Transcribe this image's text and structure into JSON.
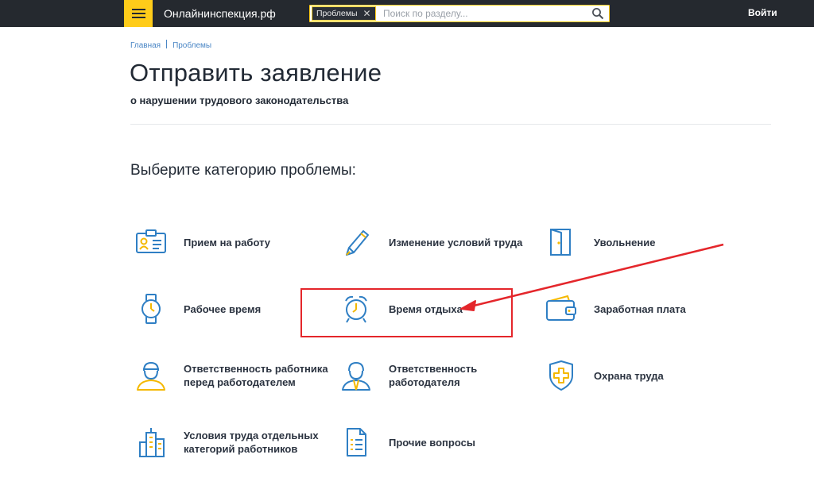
{
  "header": {
    "site_name": "Онлайнинспекция.рф",
    "search_tag": "Проблемы",
    "search_placeholder": "Поиск по разделу...",
    "login_label": "Войти",
    "brand_color": "#ffcc1a"
  },
  "breadcrumb": [
    {
      "label": "Главная"
    },
    {
      "label": "Проблемы"
    }
  ],
  "page": {
    "title": "Отправить заявление",
    "subtitle": "о нарушении трудового законодательства",
    "section_title": "Выберите категорию проблемы:"
  },
  "categories": [
    {
      "label": "Прием на работу",
      "icon": "id-badge-icon"
    },
    {
      "label": "Изменение условий труда",
      "icon": "pen-icon"
    },
    {
      "label": "Увольнение",
      "icon": "door-exit-icon"
    },
    {
      "label": "Рабочее время",
      "icon": "wristwatch-icon"
    },
    {
      "label": "Время отдыха",
      "icon": "alarm-clock-icon"
    },
    {
      "label": "Заработная плата",
      "icon": "wallet-icon"
    },
    {
      "label": "Ответственность работника перед работодателем",
      "line1": "Ответственность работника",
      "line2": "перед работодателем",
      "icon": "worker-icon"
    },
    {
      "label": "Ответственность работодателя",
      "line1": "Ответственность",
      "line2": "работодателя",
      "icon": "employer-icon"
    },
    {
      "label": "Охрана труда",
      "icon": "shield-cross-icon"
    },
    {
      "label": "Условия труда отдельных категорий работников",
      "line1": "Условия труда отдельных",
      "line2": "категорий работников",
      "icon": "buildings-icon"
    },
    {
      "label": "Прочие вопросы",
      "icon": "document-list-icon"
    }
  ],
  "annotation": {
    "highlight_color": "#e4262b",
    "highlighted_category": "Время отдыха"
  }
}
